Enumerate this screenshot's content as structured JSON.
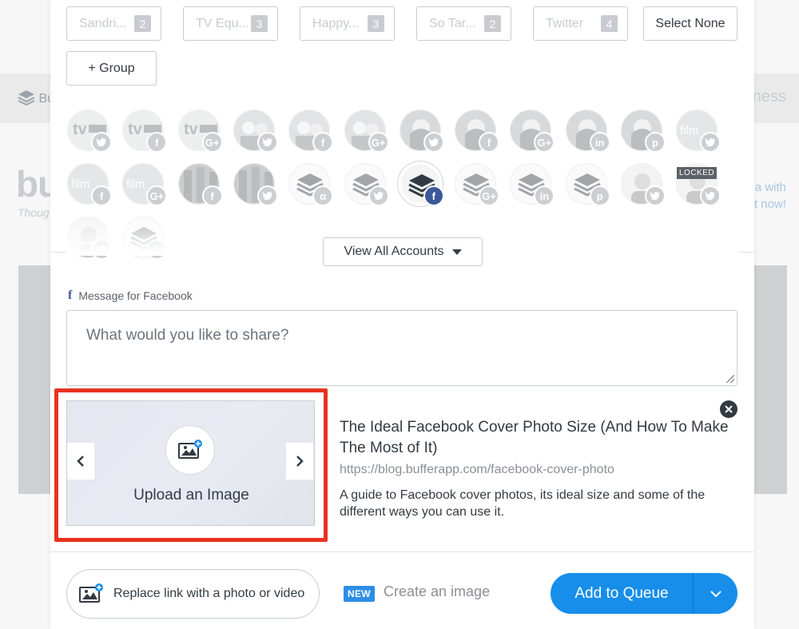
{
  "background": {
    "nav_logo_text": "Bu",
    "nav_right_text": "iness",
    "title": "bu",
    "subtitle": "Thoug",
    "promo_line1": "a with",
    "promo_line2": "t now!"
  },
  "groups": [
    {
      "label": "Sandri...",
      "count": "2"
    },
    {
      "label": "TV Equ...",
      "count": "3"
    },
    {
      "label": "Happy...",
      "count": "3"
    },
    {
      "label": "So Tar...",
      "count": "2"
    },
    {
      "label": "Twitter",
      "count": "4"
    }
  ],
  "select_none_label": "Select None",
  "add_group_label": "+ Group",
  "accounts": {
    "row1": [
      {
        "avatar": "tv-logo",
        "network": "twitter"
      },
      {
        "avatar": "tv-logo",
        "network": "facebook"
      },
      {
        "avatar": "tv-logo",
        "network": "google-plus"
      },
      {
        "avatar": "people-photo",
        "network": "twitter"
      },
      {
        "avatar": "people-photo",
        "network": "facebook"
      },
      {
        "avatar": "people-photo",
        "network": "google-plus"
      },
      {
        "avatar": "woman-photo",
        "network": "twitter"
      },
      {
        "avatar": "woman-photo",
        "network": "facebook"
      },
      {
        "avatar": "woman-photo",
        "network": "google-plus"
      },
      {
        "avatar": "woman-photo",
        "network": "linkedin"
      },
      {
        "avatar": "woman-photo",
        "network": "pinterest"
      },
      {
        "avatar": "film-logo",
        "network": "twitter"
      }
    ],
    "row2": [
      {
        "avatar": "film-logo",
        "network": "facebook"
      },
      {
        "avatar": "film-logo",
        "network": "google-plus"
      },
      {
        "avatar": "building-photo",
        "network": "facebook"
      },
      {
        "avatar": "building-photo",
        "network": "twitter"
      },
      {
        "avatar": "buffer-logo",
        "network": "alpha"
      },
      {
        "avatar": "buffer-logo",
        "network": "twitter"
      },
      {
        "avatar": "buffer-logo",
        "network": "facebook",
        "selected": true
      },
      {
        "avatar": "buffer-logo",
        "network": "google-plus"
      },
      {
        "avatar": "buffer-logo",
        "network": "linkedin"
      },
      {
        "avatar": "buffer-logo",
        "network": "pinterest"
      },
      {
        "avatar": "man-photo",
        "network": "twitter"
      },
      {
        "avatar": "man-photo",
        "network": "twitter",
        "locked": true
      }
    ],
    "locked_label": "LOCKED"
  },
  "view_all_label": "View All Accounts",
  "message_label": "Message for Facebook",
  "composer_placeholder": "What would you like to share?",
  "upload_label": "Upload an Image",
  "link": {
    "title": "The Ideal Facebook Cover Photo Size (And How To Make The Most of It)",
    "url": "https://blog.bufferapp.com/facebook-cover-photo",
    "description": "A guide to Facebook cover photos, its ideal size and some of the different ways you can use it."
  },
  "footer": {
    "replace_label": "Replace link with a photo or video",
    "new_badge": "NEW",
    "create_image_label": "Create an image",
    "queue_label": "Add to Queue"
  },
  "colors": {
    "brand_blue": "#168eea",
    "facebook_blue": "#3b5998",
    "highlight_red": "#e8321f"
  }
}
